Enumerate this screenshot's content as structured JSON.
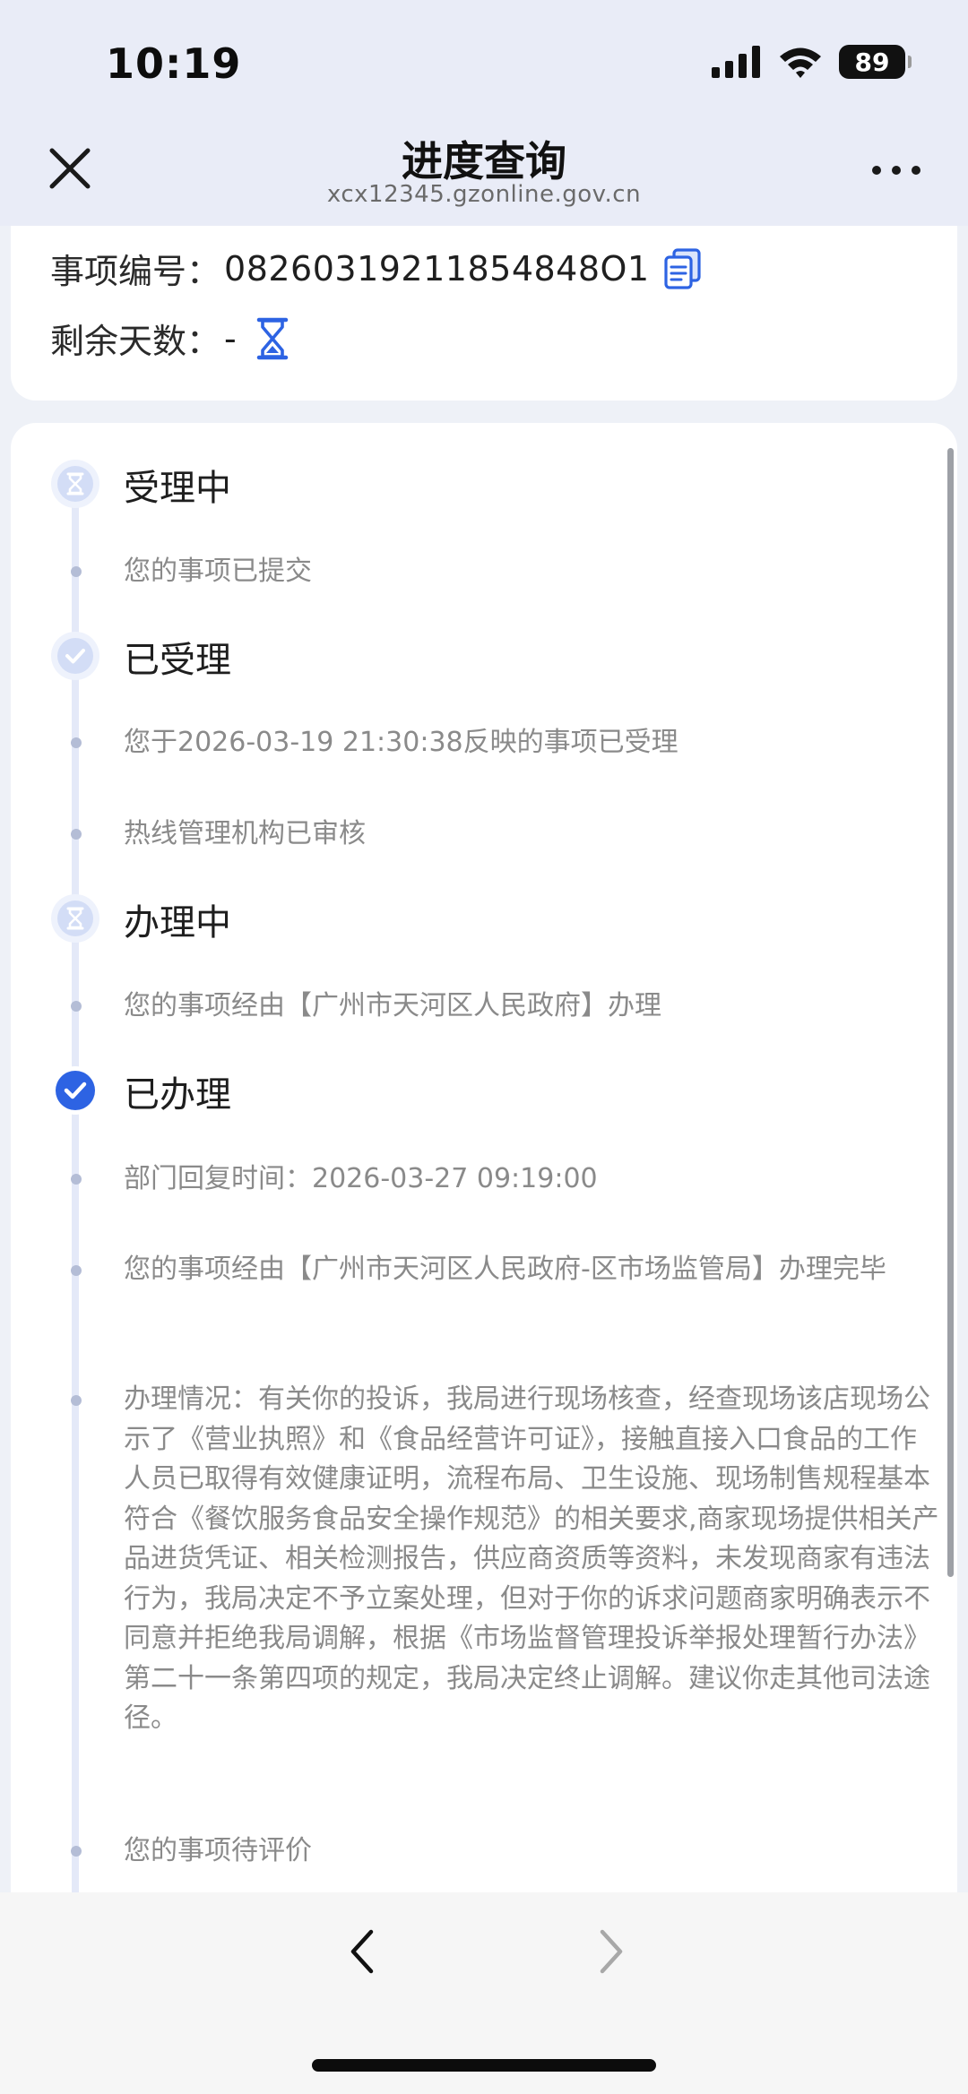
{
  "status_bar": {
    "time": "10:19",
    "battery": "89",
    "icons": [
      "signal-icon",
      "wifi-icon",
      "battery-icon"
    ]
  },
  "nav": {
    "title": "进度查询",
    "url": "xcx12345.gzonline.gov.cn",
    "close_icon": "close-icon",
    "more_icon": "more-icon"
  },
  "info": {
    "case_label": "事项编号：",
    "case_number": "08260319211854848O1",
    "days_label": "剩余天数：",
    "days_value": "-"
  },
  "timeline": {
    "stage1": {
      "title": "受理中",
      "icon": "hourglass-icon"
    },
    "stage1_entry1": "您的事项已提交",
    "stage2": {
      "title": "已受理",
      "icon": "check-icon"
    },
    "stage2_entry1": "您于2026-03-19 21:30:38反映的事项已受理",
    "stage2_entry2": "热线管理机构已审核",
    "stage3": {
      "title": "办理中",
      "icon": "hourglass-icon"
    },
    "stage3_entry1": "您的事项经由【广州市天河区人民政府】办理",
    "stage4": {
      "title": "已办理",
      "icon": "check-filled-icon"
    },
    "stage4_entry1": "部门回复时间：2026-03-27 09:19:00",
    "stage4_entry2": "您的事项经由【广州市天河区人民政府-区市场监管局】办理完毕",
    "stage4_entry3": "办理情况：有关你的投诉，我局进行现场核查，经查现场该店现场公示了《营业执照》和《食品经营许可证》，接触直接入口食品的工作人员已取得有效健康证明，流程布局、卫生设施、现场制售规程基本符合《餐饮服务食品安全操作规范》的相关要求,商家现场提供相关产品进货凭证、相关检测报告，供应商资质等资料，未发现商家有违法行为，我局决定不予立案处理，但对于你的诉求问题商家明确表示不同意并拒绝我局调解，根据《市场监督管理投诉举报处理暂行办法》第二十一条第四项的规定，我局决定终止调解。建议你走其他司法途径。",
    "stage4_entry4": "您的事项待评价"
  },
  "colors": {
    "accent": "#2d63e3",
    "accent_light": "#dde4f8",
    "background": "#eef1f7",
    "card": "#ffffff",
    "muted_text": "#8a8a8a"
  }
}
